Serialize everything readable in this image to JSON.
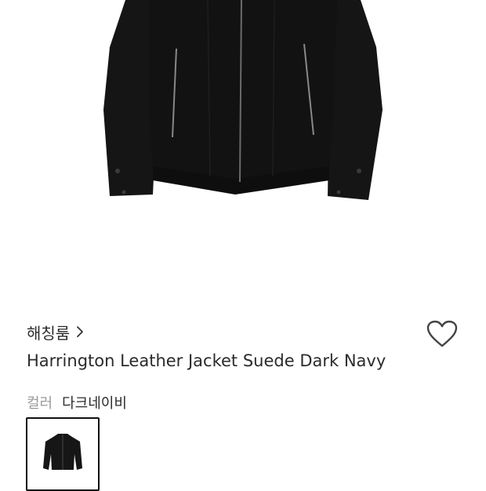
{
  "product": {
    "brand": "해칭룸",
    "title": "Harrington Leather Jacket Suede Dark Navy",
    "color_label": "컬러",
    "color_value": "다크네이비",
    "jacket_color": "#141414",
    "swatch_selected": true
  },
  "icons": {
    "brand_link": "chevron-right-icon",
    "wishlist": "heart-outline-icon"
  }
}
